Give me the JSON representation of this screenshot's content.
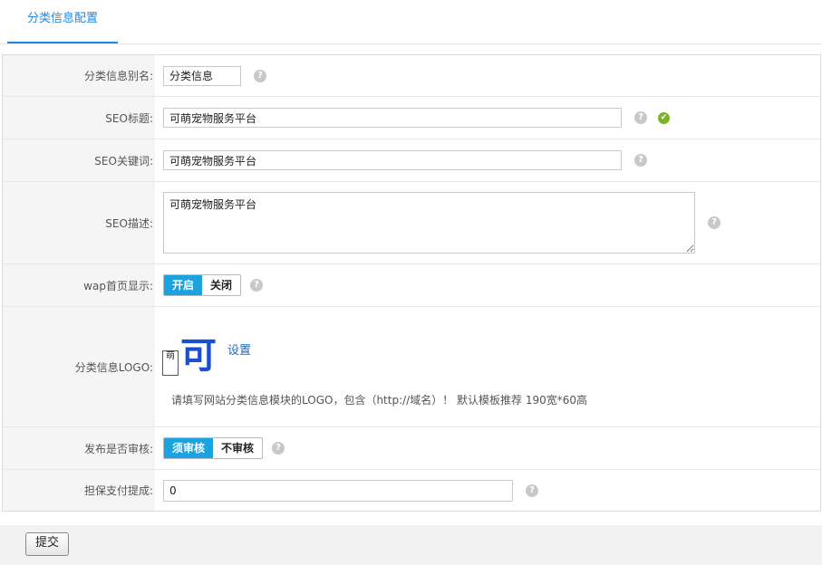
{
  "tabs": {
    "active": "分类信息配置"
  },
  "form": {
    "alias": {
      "label": "分类信息别名:",
      "value": "分类信息"
    },
    "seo_title": {
      "label": "SEO标题:",
      "value": "可萌宠物服务平台"
    },
    "seo_keywords": {
      "label": "SEO关键词:",
      "value": "可萌宠物服务平台"
    },
    "seo_desc": {
      "label": "SEO描述:",
      "value": "可萌宠物服务平台"
    },
    "wap_home": {
      "label": "wap首页显示:",
      "on": "开启",
      "off": "关闭"
    },
    "logo": {
      "label": "分类信息LOGO:",
      "glyph": "可",
      "seal": "萌",
      "set_link": "设置",
      "hint": "请填写网站分类信息模块的LOGO，包含（http://域名）！ 默认模板推荐 190宽*60高"
    },
    "audit": {
      "label": "发布是否审核:",
      "on": "须审核",
      "off": "不审核"
    },
    "escrow": {
      "label": "担保支付提成:",
      "value": "0"
    }
  },
  "icons": {
    "help": "?",
    "ok": "✔"
  },
  "footer": {
    "submit": "提交"
  }
}
